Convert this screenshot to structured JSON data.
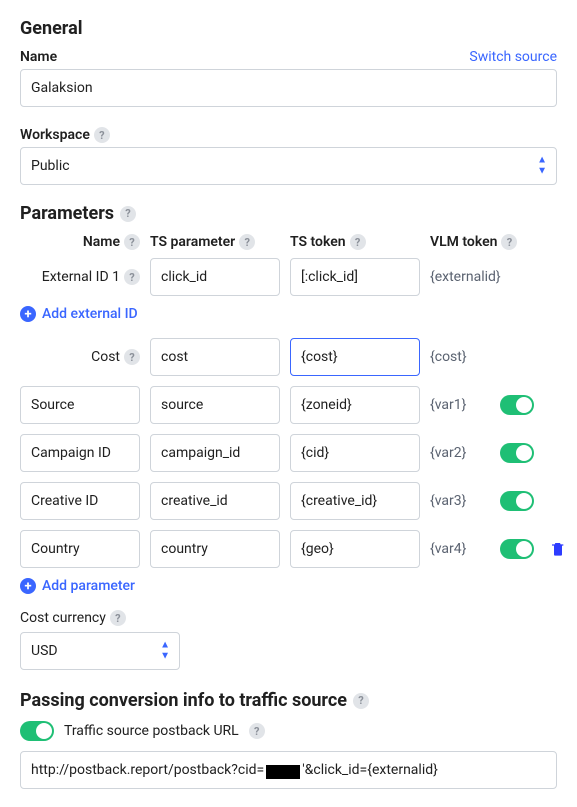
{
  "general": {
    "title": "General",
    "name_label": "Name",
    "switch_source": "Switch source",
    "name_value": "Galaksion",
    "workspace_label": "Workspace",
    "workspace_value": "Public"
  },
  "parameters": {
    "title": "Parameters",
    "headers": {
      "name": "Name",
      "ts_parameter": "TS parameter",
      "ts_token": "TS token",
      "vlm_token": "VLM token"
    },
    "external": {
      "label": "External ID 1",
      "ts_parameter": "click_id",
      "ts_token": "[:click_id]",
      "vlm_token": "{externalid}"
    },
    "add_external": "Add external ID",
    "cost": {
      "label": "Cost",
      "ts_parameter": "cost",
      "ts_token": "{cost}",
      "vlm_token": "{cost}"
    },
    "rows": [
      {
        "name": "Source",
        "ts_parameter": "source",
        "ts_token": "{zoneid}",
        "vlm_token": "{var1}"
      },
      {
        "name": "Campaign ID",
        "ts_parameter": "campaign_id",
        "ts_token": "{cid}",
        "vlm_token": "{var2}"
      },
      {
        "name": "Creative ID",
        "ts_parameter": "creative_id",
        "ts_token": "{creative_id}",
        "vlm_token": "{var3}"
      },
      {
        "name": "Country",
        "ts_parameter": "country",
        "ts_token": "{geo}",
        "vlm_token": "{var4}"
      }
    ],
    "add_parameter": "Add parameter"
  },
  "cost_currency": {
    "label": "Cost currency",
    "value": "USD"
  },
  "postback": {
    "title": "Passing conversion info to traffic source",
    "toggle_label": "Traffic source postback URL",
    "url_prefix": "http://postback.report/postback?cid=",
    "url_suffix": "'&click_id={externalid}"
  }
}
